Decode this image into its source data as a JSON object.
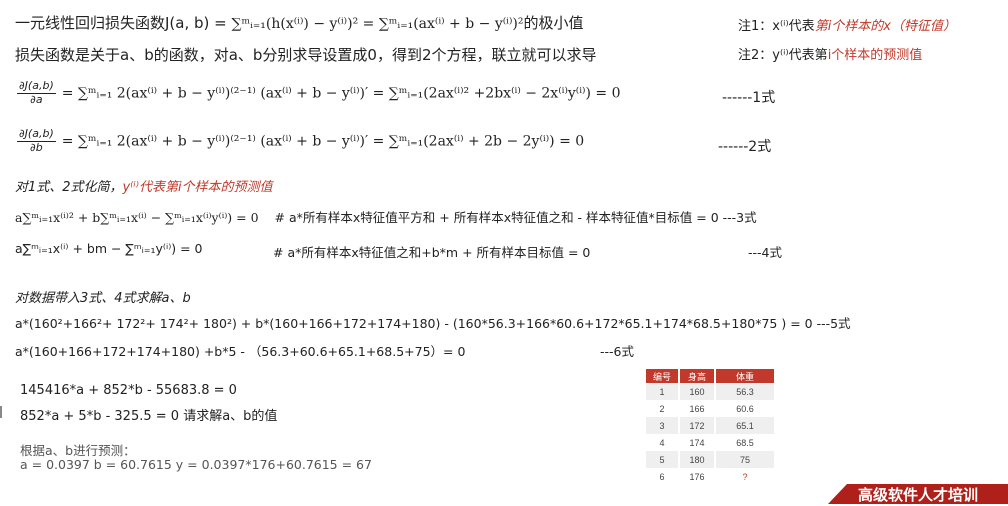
{
  "header": {
    "title_prefix": "一元线性回归损失函数J(a, b) = ",
    "title_formula": "∑ᵐᵢ₌₁(h(x⁽ⁱ⁾) − y⁽ⁱ⁾)² = ∑ᵐᵢ₌₁(ax⁽ⁱ⁾ + b − y⁽ⁱ⁾)²",
    "title_suffix": "的极小值",
    "subtitle": "损失函数是关于a、b的函数，对a、b分别求导设置成0，得到2个方程，联立就可以求导"
  },
  "notes": {
    "note1_prefix": "注1：x⁽ⁱ⁾代表",
    "note1_red": "第i个样本的x（特征值）",
    "note2_prefix": "注2：y⁽ⁱ⁾代表第",
    "note2_red": "i个样本的预测值"
  },
  "equations": {
    "eq1_num": "∂J(a,b)",
    "eq1_den": "∂a",
    "eq1_body": "= ∑ᵐᵢ₌₁ 2(ax⁽ⁱ⁾ + b −  y⁽ⁱ⁾)⁽²⁻¹⁾ (ax⁽ⁱ⁾ + b −  y⁽ⁱ⁾)′ = ∑ᵐᵢ₌₁(2ax⁽ⁱ⁾² +2bx⁽ⁱ⁾ − 2x⁽ⁱ⁾y⁽ⁱ⁾) = 0",
    "eq1_tag": "------1式",
    "eq2_num": "∂J(a,b)",
    "eq2_den": "∂b",
    "eq2_body": "= ∑ᵐᵢ₌₁ 2(ax⁽ⁱ⁾ + b −  y⁽ⁱ⁾)⁽²⁻¹⁾ (ax⁽ⁱ⁾ + b −  y⁽ⁱ⁾)′ = ∑ᵐᵢ₌₁(2ax⁽ⁱ⁾ + 2b − 2y⁽ⁱ⁾) = 0",
    "eq2_tag": "------2式"
  },
  "simplify": {
    "heading_prefix": "对1式、2式化简，",
    "heading_red": "y⁽ⁱ⁾代表第i个样本的预测值",
    "eq3": "a∑ᵐᵢ₌₁x⁽ⁱ⁾² + b∑ᵐᵢ₌₁x⁽ⁱ⁾ − ∑ᵐᵢ₌₁x⁽ⁱ⁾y⁽ⁱ⁾) = 0",
    "eq3_comment": "# a*所有样本x特征值平方和 + 所有样本x特征值之和 - 样本特征值*目标值 = 0  ---3式",
    "eq4": "a∑ᵐᵢ₌₁x⁽ⁱ⁾ + bm − ∑ᵐᵢ₌₁y⁽ⁱ⁾) = 0",
    "eq4_comment": "# a*所有样本x特征值之和+b*m + 所有样本目标值 = 0",
    "eq4_tag": "---4式"
  },
  "solve": {
    "heading": "对数据带入3式、4式求解a、b",
    "eq5": "a*(160²+166²+ 172²+ 174²+ 180²)  + b*(160+166+172+174+180) - (160*56.3+166*60.6+172*65.1+174*68.5+180*75 ) = 0  ---5式",
    "eq6": "a*(160+166+172+174+180)  +b*5 -  （56.3+60.6+65.1+68.5+75）= 0",
    "eq6_tag": "---6式",
    "line1": "145416*a + 852*b - 55683.8 = 0",
    "line2": "852*a +  5*b  - 325.5 = 0    请求解a、b的值",
    "predict_label": "根据a、b进行预测：",
    "predict_value": "a = 0.0397 b = 60.7615 y = 0.0397*176+60.7615 = 67"
  },
  "table": {
    "headers": [
      "编号",
      "身高",
      "体重"
    ],
    "rows": [
      [
        "1",
        "160",
        "56.3"
      ],
      [
        "2",
        "166",
        "60.6"
      ],
      [
        "3",
        "172",
        "65.1"
      ],
      [
        "4",
        "174",
        "68.5"
      ],
      [
        "5",
        "180",
        "75"
      ],
      [
        "6",
        "176",
        "?"
      ]
    ],
    "header_color": "#c0392b"
  },
  "footer": {
    "text": "高级软件人才培训"
  }
}
